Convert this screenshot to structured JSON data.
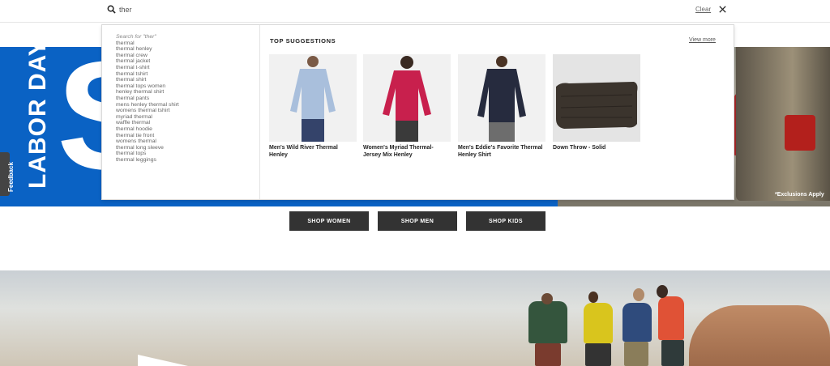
{
  "search": {
    "value": "ther",
    "clear_label": "Clear"
  },
  "suggestions": {
    "header": "Search for \"ther\"",
    "items": [
      "thermal",
      "thermal henley",
      "thermal crew",
      "thermal jacket",
      "thermal t-shirt",
      "thermal tshirt",
      "thermal shirt",
      "thermal tops women",
      "henley thermal shirt",
      "thermal pants",
      "mens henley thermal shirt",
      "womens thermal tshirt",
      "myriad thermal",
      "waffle thermal",
      "thermal hoodie",
      "thermal tie front",
      "womens thermal",
      "thermal long sleeve",
      "thermal tops",
      "thermal leggings"
    ]
  },
  "top_suggestions": {
    "title": "TOP SUGGESTIONS",
    "view_more": "View more",
    "products": [
      {
        "name": "Men's Wild River Thermal Henley",
        "color": "#a9bfdc"
      },
      {
        "name": "Women's Myriad Thermal-Jersey Mix Henley",
        "color": "#c8204d"
      },
      {
        "name": "Men's Eddie's Favorite Thermal Henley Shirt",
        "color": "#262b3e"
      },
      {
        "name": "Down Throw - Solid",
        "color": "#3b342d"
      }
    ]
  },
  "hero": {
    "vertical_text": "LABOR DAY",
    "big_letter": "S",
    "exclusions": "*Exclusions Apply"
  },
  "feedback_label": "Feedback",
  "shop_buttons": [
    "SHOP WOMEN",
    "SHOP MEN",
    "SHOP KIDS"
  ],
  "colors": {
    "hero_blue": "#0a62c4",
    "button_bg": "#333333"
  }
}
